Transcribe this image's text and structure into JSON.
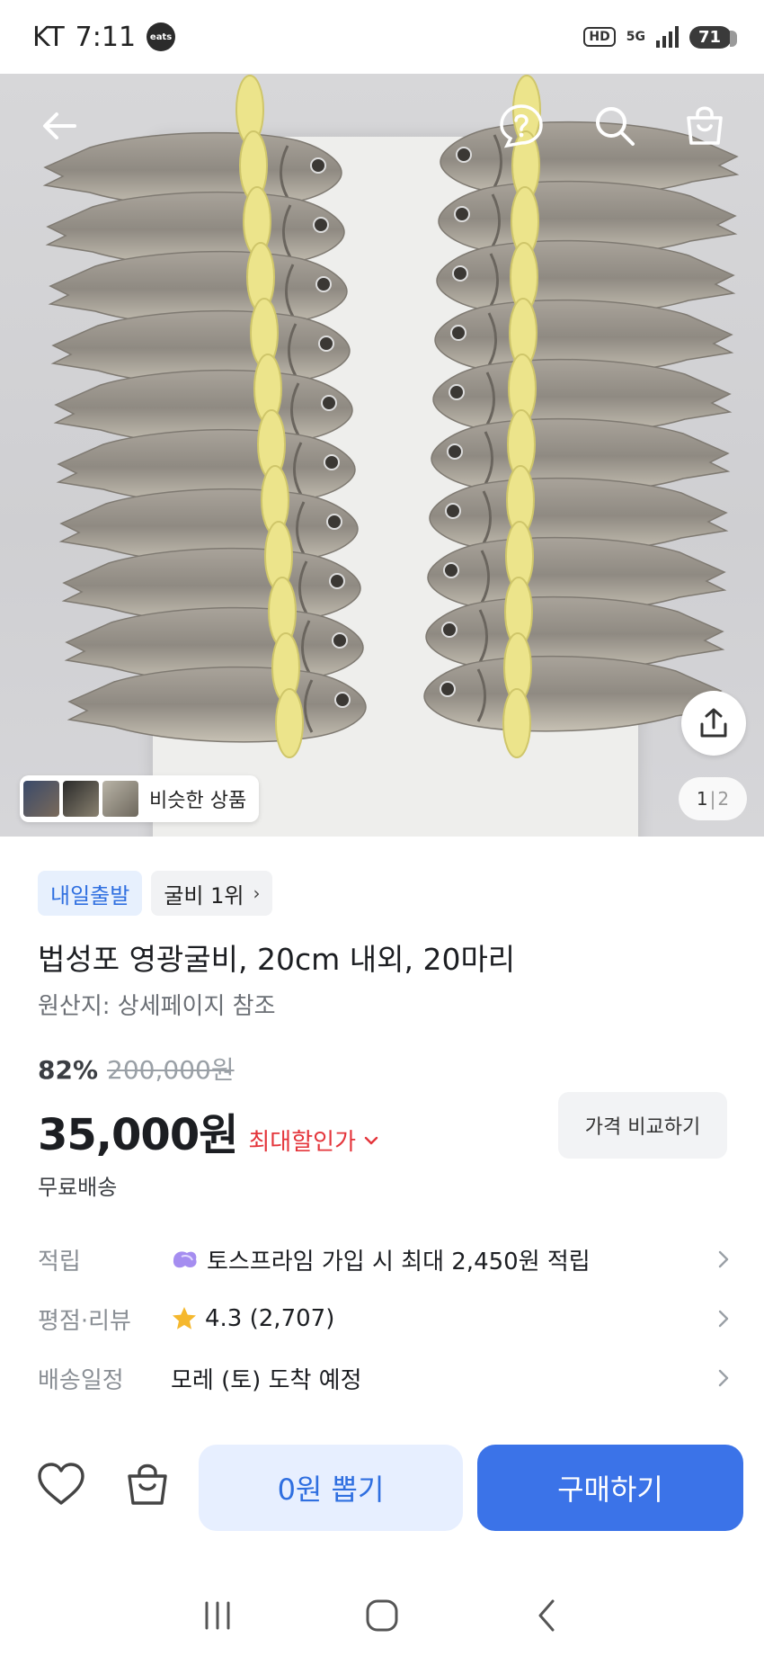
{
  "status_bar": {
    "carrier": "KT",
    "time": "7:11",
    "app_badge": "eats",
    "hd_label": "HD",
    "network": "5G",
    "battery": "71"
  },
  "hero": {
    "similar_label": "비슷한 상품",
    "pager_current": "1",
    "pager_sep": "|",
    "pager_total": "2"
  },
  "badges": {
    "delivery": "내일출발",
    "rank": "굴비 1위"
  },
  "product": {
    "title": "법성포 영광굴비, 20cm 내외, 20마리",
    "origin": "원산지: 상세페이지 참조",
    "discount_rate": "82%",
    "original_price": "200,000원",
    "price": "35,000원",
    "max_discount_label": "최대할인가",
    "compare_label": "가격 비교하기",
    "shipping": "무료배송"
  },
  "details": [
    {
      "label": "적립",
      "value": "토스프라임 가입 시 최대 2,450원 적립"
    },
    {
      "label": "평점·리뷰",
      "value": "4.3 (2,707)"
    },
    {
      "label": "배송일정",
      "value": "모레 (토) 도착 예정"
    }
  ],
  "actions": {
    "coupon": "0원 뽑기",
    "buy": "구매하기"
  },
  "colors": {
    "accent": "#3b73e8",
    "discount_red": "#e4353b",
    "star": "#f5b82e"
  }
}
